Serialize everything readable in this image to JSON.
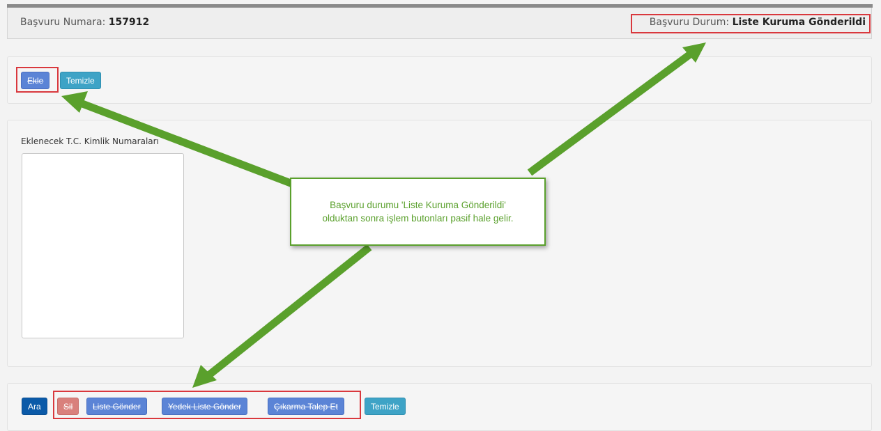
{
  "header": {
    "basvuru_numara_label": "Başvuru Numara:",
    "basvuru_numara_value": "157912",
    "basvuru_durum_label": "Başvuru Durum:",
    "basvuru_durum_value": "Liste Kuruma Gönderildi"
  },
  "top_actions": {
    "ekle": "Ekle",
    "temizle": "Temizle"
  },
  "form": {
    "tc_label": "Eklenecek T.C. Kimlik Numaraları",
    "tc_value": ""
  },
  "bottom_actions": {
    "ara": "Ara",
    "sil": "Sil",
    "liste_gonder": "Liste Gönder",
    "yedek_liste_gonder": "Yedek Liste Gönder",
    "cikarma_talep_et": "Çıkarma Talep Et",
    "temizle": "Temizle"
  },
  "annotation": {
    "line1": "Başvuru durumu 'Liste Kuruma Gönderildi'",
    "line2": "olduktan sonra işlem butonları pasif hale gelir."
  },
  "colors": {
    "arrow_green": "#5aa02c",
    "highlight_red": "#d9383d",
    "button_blue": "#5b84d6",
    "button_teal": "#3ea3c6",
    "button_navy": "#0b5aa8",
    "button_red": "#d9807c"
  }
}
